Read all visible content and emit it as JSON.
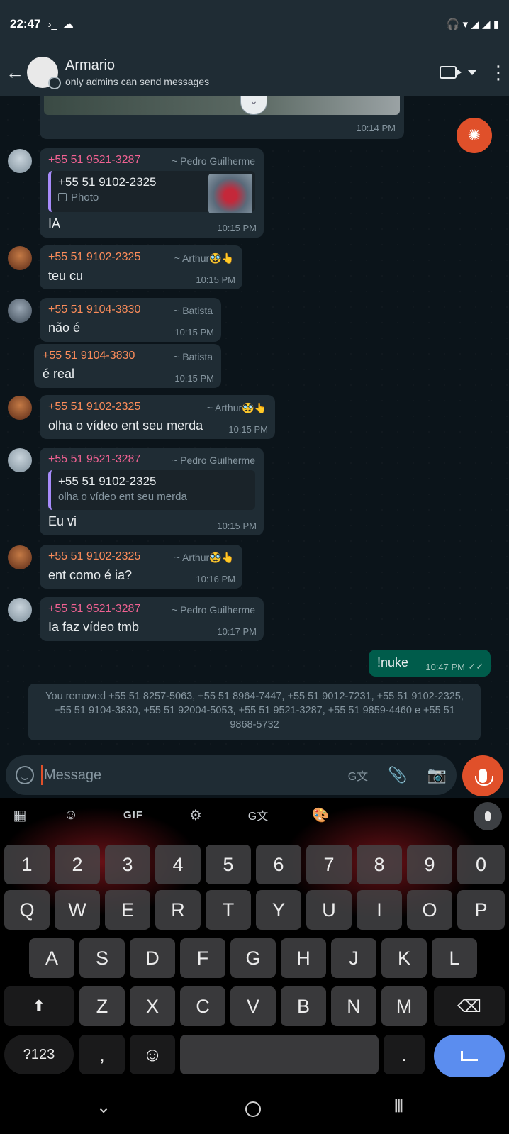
{
  "status_bar": {
    "time": "22:47",
    "terminal_glyph": "›_",
    "cloud_glyph": "☁",
    "right_icons": "🎧 ▾ ◢ ◢ ▮"
  },
  "header": {
    "title": "Armario",
    "subtitle": "only admins can send messages",
    "back_glyph": "←",
    "more_glyph": "⋮"
  },
  "previous_message": {
    "time": "10:14 PM",
    "chevron": "⌄"
  },
  "messages": [
    {
      "phone": "+55 51 9521-3287",
      "name": "~ Pedro Guilherme",
      "quote_name": "+55 51 9102-2325",
      "quote_text": "Photo",
      "text": "IA",
      "time": "10:15 PM"
    },
    {
      "phone": "+55 51 9102-2325",
      "name": "~ Arthur🥸👆",
      "text": "teu cu",
      "time": "10:15 PM"
    },
    {
      "phone": "+55 51 9104-3830",
      "name": "~ Batista",
      "text": "não é",
      "time": "10:15 PM"
    },
    {
      "phone": "+55 51 9104-3830",
      "name": "~ Batista",
      "text": "é real",
      "time": "10:15 PM"
    },
    {
      "phone": "+55 51 9102-2325",
      "name": "~ Arthur🥸👆",
      "text": "olha o vídeo ent seu merda",
      "time": "10:15 PM"
    },
    {
      "phone": "+55 51 9521-3287",
      "name": "~ Pedro Guilherme",
      "quote_name": "+55 51 9102-2325",
      "quote_text": "olha o vídeo ent seu merda",
      "text": "Eu vi",
      "time": "10:15 PM"
    },
    {
      "phone": "+55 51 9102-2325",
      "name": "~ Arthur🥸👆",
      "text": "ent como é ia?",
      "time": "10:16 PM"
    },
    {
      "phone": "+55 51 9521-3287",
      "name": "~ Pedro Guilherme",
      "text": "Ia faz vídeo tmb",
      "time": "10:17 PM"
    }
  ],
  "outgoing": {
    "text": "!nuke",
    "time": "10:47 PM",
    "check": "✓✓"
  },
  "system_message": "You removed +55 51 8257-5063, +55 51 8964-7447, +55 51 9012-7231, +55 51 9102-2325, +55 51 9104-3830, +55 51 92004-5053, +55 51 9521-3287, +55 51 9859-4460 e +55 51 9868-5732",
  "composer": {
    "placeholder": "Message",
    "translate_glyph": "G文",
    "attach_glyph": "📎",
    "camera_glyph": "📷"
  },
  "keyboard": {
    "toolbar": {
      "apps": "▦",
      "sticker": "☺",
      "gif": "GIF",
      "settings": "⚙",
      "translate": "G文",
      "theme": "🎨"
    },
    "row_numbers": [
      "1",
      "2",
      "3",
      "4",
      "5",
      "6",
      "7",
      "8",
      "9",
      "0"
    ],
    "row_top": [
      "Q",
      "W",
      "E",
      "R",
      "T",
      "Y",
      "U",
      "I",
      "O",
      "P"
    ],
    "row_home": [
      "A",
      "S",
      "D",
      "F",
      "G",
      "H",
      "J",
      "K",
      "L"
    ],
    "row_bottom": [
      "Z",
      "X",
      "C",
      "V",
      "B",
      "N",
      "M"
    ],
    "shift": "⬆",
    "backspace": "⌫",
    "symbols": "?123",
    "comma": ",",
    "emoji": "☺",
    "period": "."
  },
  "nav": {
    "back": "⌄",
    "recent": "|||"
  },
  "colors": {
    "accent": "#e0502a",
    "outgoing_bubble": "#005c4b",
    "incoming_bubble": "#1f2c34",
    "phone_pink": "#f06292",
    "phone_orange": "#fb8c5a"
  }
}
